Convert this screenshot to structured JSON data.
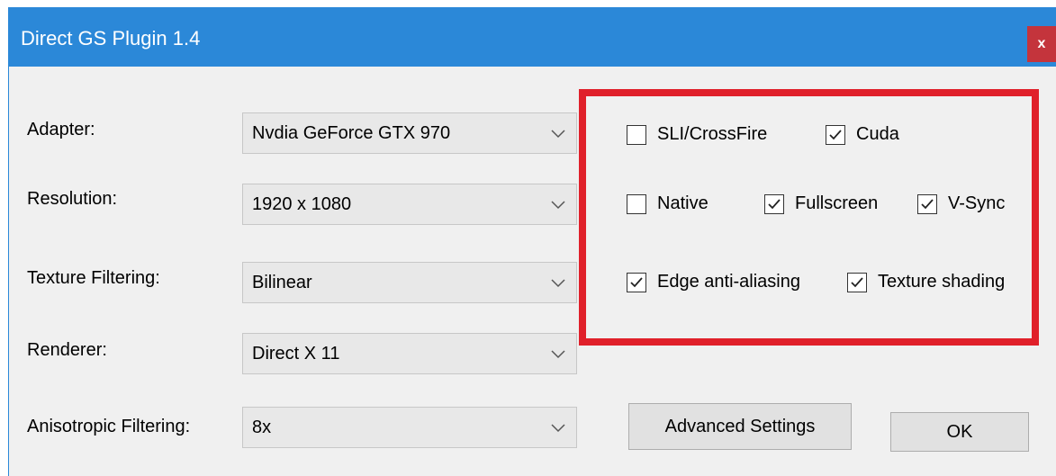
{
  "window": {
    "title": "Direct GS Plugin 1.4",
    "close_label": "x",
    "accent_color": "#2b88d8",
    "close_color": "#c4343c"
  },
  "fields": [
    {
      "label": "Adapter:",
      "value": "Nvdia GeForce GTX 970"
    },
    {
      "label": "Resolution:",
      "value": "1920 x 1080"
    },
    {
      "label": "Texture Filtering:",
      "value": "Bilinear"
    },
    {
      "label": "Renderer:",
      "value": "Direct X 11"
    },
    {
      "label": "Anisotropic Filtering:",
      "value": "8x"
    }
  ],
  "options": [
    {
      "label": "SLI/CrossFire",
      "checked": false
    },
    {
      "label": "Cuda",
      "checked": true
    },
    {
      "label": "Native",
      "checked": false
    },
    {
      "label": "Fullscreen",
      "checked": true
    },
    {
      "label": "V-Sync",
      "checked": true
    },
    {
      "label": "Edge anti-aliasing",
      "checked": true
    },
    {
      "label": "Texture shading",
      "checked": true
    }
  ],
  "highlight_color": "#e0202a",
  "buttons": {
    "advanced": "Advanced Settings",
    "ok": "OK"
  }
}
